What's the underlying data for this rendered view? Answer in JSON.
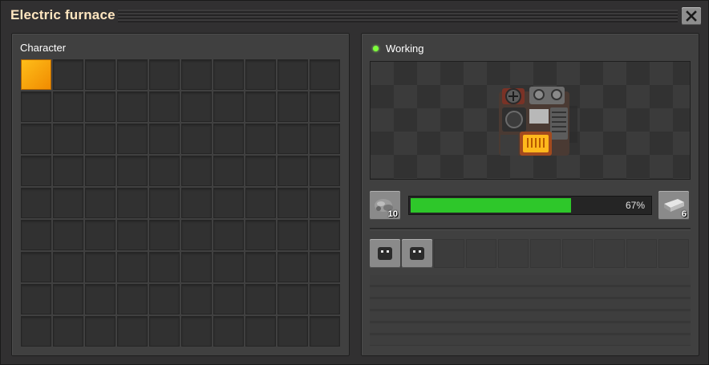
{
  "window": {
    "title": "Electric furnace"
  },
  "character_panel": {
    "label": "Character",
    "rows": 9,
    "columns": 10,
    "selected_slot": 0
  },
  "entity_panel": {
    "status": {
      "text": "Working",
      "color": "#7dff3a"
    },
    "preview_icon": "electric-furnace-icon",
    "input": {
      "icon": "stone-icon",
      "count": "10"
    },
    "output": {
      "icon": "stone-brick-icon",
      "count": "6"
    },
    "progress": {
      "value": 0.67,
      "label": "67%",
      "color": "#2ec72a"
    },
    "module_slots": [
      {
        "icon": "module-slot-icon"
      },
      {
        "icon": "module-slot-icon"
      }
    ]
  }
}
